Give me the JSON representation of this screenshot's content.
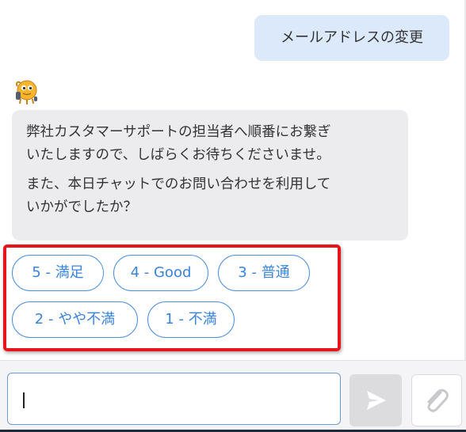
{
  "messages": {
    "user": "メールアドレスの変更",
    "bot_paragraph_1_line_1": "弊社カスタマーサポートの担当者へ順番にお繋ぎ",
    "bot_paragraph_1_line_2": "いたしますので、しばらくお待ちくださいませ。",
    "bot_paragraph_2_line_1": "また、本日チャットでのお問い合わせを利用して",
    "bot_paragraph_2_line_2": "いかがでしたか？"
  },
  "quick_replies": [
    {
      "label": "5 - 満足"
    },
    {
      "label": "4 - Good"
    },
    {
      "label": "3 - 普通"
    },
    {
      "label": "2 - やや不満"
    },
    {
      "label": "1 - 不満"
    }
  ],
  "composer": {
    "input_value": "",
    "send_icon": "send-icon",
    "attach_icon": "paperclip-icon"
  },
  "colors": {
    "user_bubble": "#dbe9fa",
    "bot_bubble": "#ececef",
    "quick_reply_border": "#4a90e2",
    "highlight_border": "#e8141c",
    "send_button": "#dcdcdf"
  }
}
